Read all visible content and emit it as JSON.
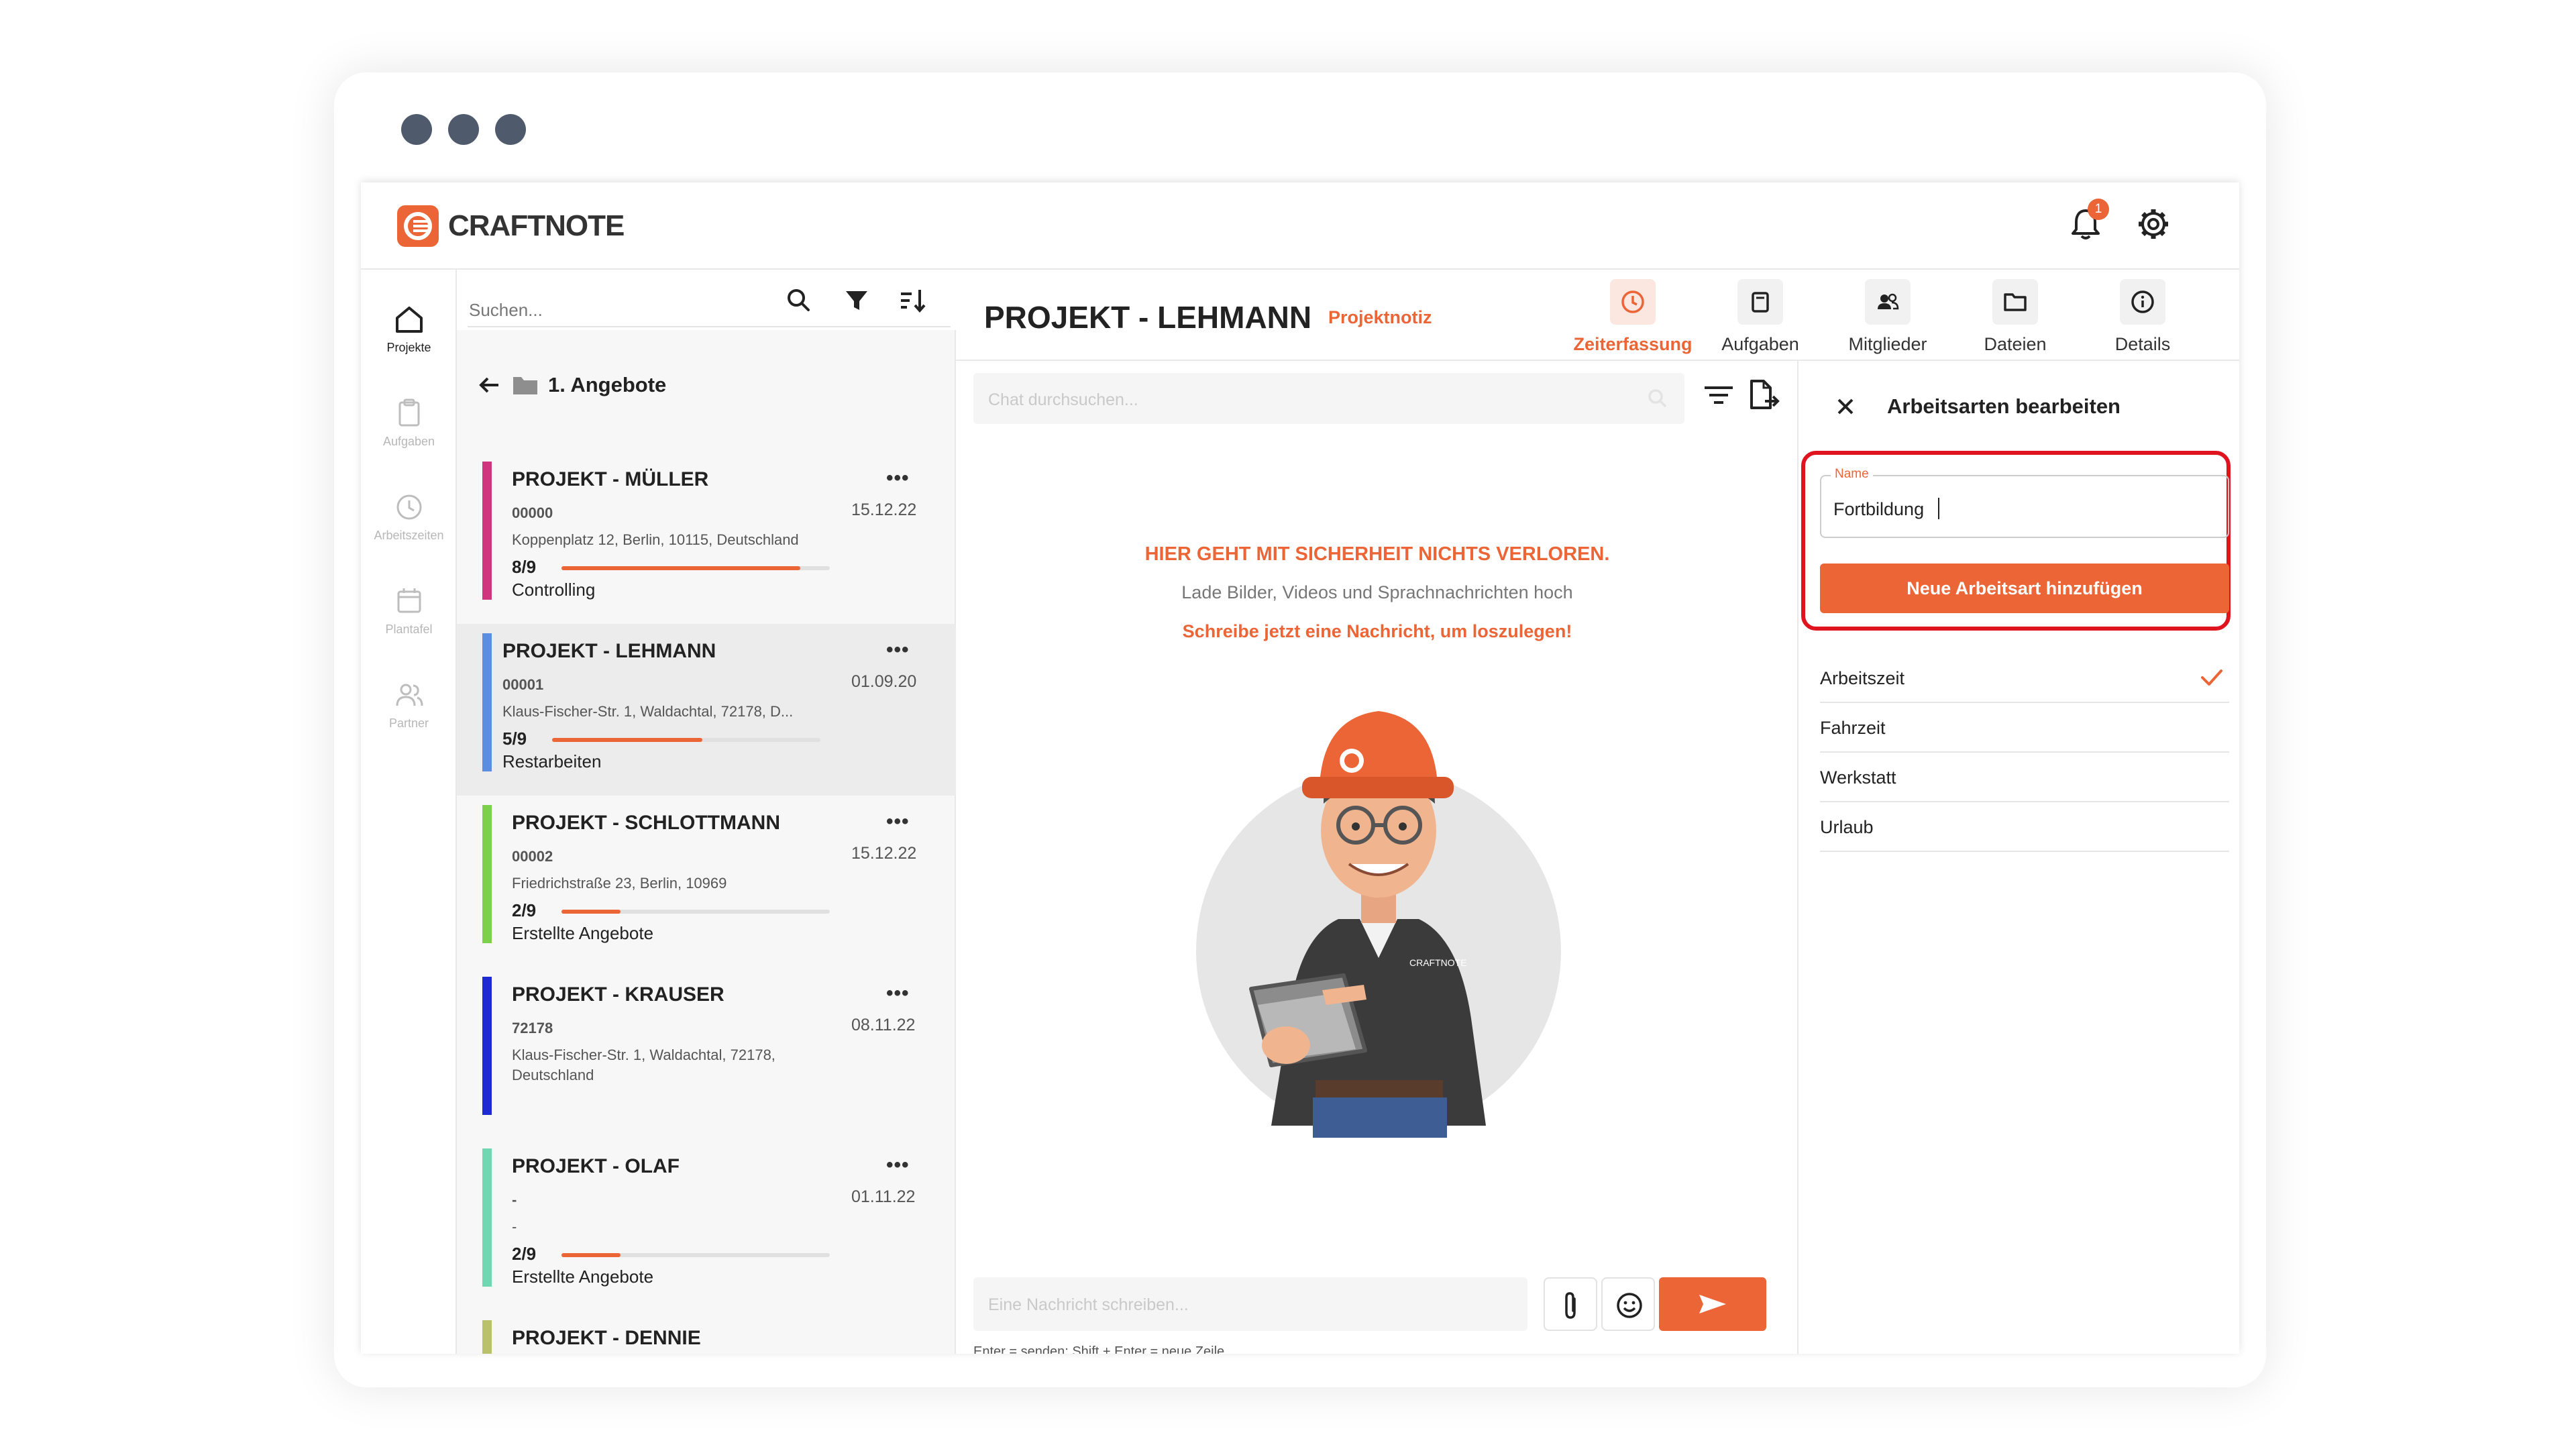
{
  "app": {
    "name": "CRAFTNOTE",
    "accent": "#eb6536",
    "highlight": "#e0141e"
  },
  "header": {
    "notification_count": "1",
    "bell_icon": "bell-icon",
    "settings_icon": "gear-icon"
  },
  "nav": {
    "items": [
      {
        "label": "Projekte",
        "icon": "home-icon",
        "active": true
      },
      {
        "label": "Aufgaben",
        "icon": "clipboard-icon"
      },
      {
        "label": "Arbeitszeiten",
        "icon": "clock-icon"
      },
      {
        "label": "Plantafel",
        "icon": "calendar-icon"
      },
      {
        "label": "Partner",
        "icon": "users-icon"
      }
    ]
  },
  "projects": {
    "search_placeholder": "Suchen...",
    "folder": "1. Angebote",
    "fab_label": "+",
    "items": [
      {
        "title": "PROJEKT - MÜLLER",
        "number": "00000",
        "date": "15.12.22",
        "address": "Koppenplatz 12, Berlin, 10115, Deutschland",
        "progress_label": "8/9",
        "progress": 0.89,
        "status": "Controlling",
        "color": "#d1357e"
      },
      {
        "title": "PROJEKT - LEHMANN",
        "number": "00001",
        "date": "01.09.20",
        "address": "Klaus-Fischer-Str. 1, Waldachtal, 72178, D...",
        "progress_label": "5/9",
        "progress": 0.56,
        "status": "Restarbeiten",
        "color": "#5b8ee0"
      },
      {
        "title": "PROJEKT - SCHLOTTMANN",
        "number": "00002",
        "date": "15.12.22",
        "address": "Friedrichstraße 23, Berlin, 10969",
        "progress_label": "2/9",
        "progress": 0.22,
        "status": "Erstellte Angebote",
        "color": "#7ed04a"
      },
      {
        "title": "PROJEKT - KRAUSER",
        "number": "72178",
        "date": "08.11.22",
        "address": "Klaus-Fischer-Str. 1, Waldachtal, 72178, Deutschland",
        "progress_label": "",
        "progress": null,
        "status": "",
        "color": "#1f2bd2"
      },
      {
        "title": "PROJEKT - OLAF",
        "number": "-",
        "date": "01.11.22",
        "address": "-",
        "progress_label": "2/9",
        "progress": 0.22,
        "status": "Erstellte Angebote",
        "color": "#6fd8b2"
      },
      {
        "title": "PROJEKT - DENNIE",
        "number": "",
        "date": "",
        "address": "",
        "progress_label": "",
        "progress": null,
        "status": "",
        "color": "#b9c26a"
      }
    ]
  },
  "project": {
    "title": "PROJEKT - LEHMANN",
    "tag": "Projektnotiz",
    "tabs": [
      {
        "label": "Zeiterfassung",
        "icon": "clock-icon",
        "active": true
      },
      {
        "label": "Aufgaben",
        "icon": "clipboard-icon"
      },
      {
        "label": "Mitglieder",
        "icon": "members-icon"
      },
      {
        "label": "Dateien",
        "icon": "folder-icon"
      },
      {
        "label": "Details",
        "icon": "info-icon"
      }
    ]
  },
  "chat": {
    "search_placeholder": "Chat durchsuchen...",
    "headline": "HIER GEHT MIT SICHERHEIT NICHTS VERLOREN.",
    "subline": "Lade Bilder, Videos und Sprachnachrichten hoch",
    "cta": "Schreibe jetzt eine Nachricht, um loszulegen!",
    "shirt_logo": "CRAFTNOTE",
    "message_placeholder": "Eine Nachricht schreiben...",
    "hint": "Enter = senden; Shift + Enter = neue Zeile"
  },
  "panel": {
    "title": "Arbeitsarten bearbeiten",
    "field_label": "Name",
    "field_value": "Fortbildung",
    "add_button": "Neue Arbeitsart hinzufügen",
    "types": [
      {
        "label": "Arbeitszeit",
        "checked": true
      },
      {
        "label": "Fahrzeit",
        "checked": false
      },
      {
        "label": "Werkstatt",
        "checked": false
      },
      {
        "label": "Urlaub",
        "checked": false
      }
    ]
  }
}
